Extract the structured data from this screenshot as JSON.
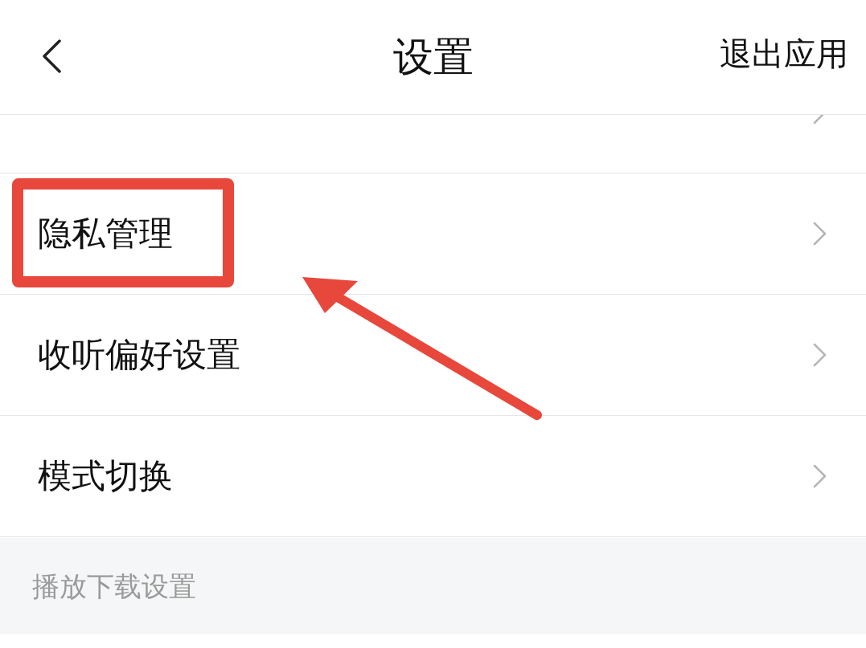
{
  "header": {
    "title": "设置",
    "action": "退出应用"
  },
  "rows": [
    {
      "kind": "cut",
      "highlighted": false
    },
    {
      "kind": "item",
      "label": "隐私管理",
      "highlighted": true
    },
    {
      "kind": "item",
      "label": "收听偏好设置",
      "highlighted": false
    },
    {
      "kind": "item",
      "label": "模式切换",
      "highlighted": false
    }
  ],
  "section_header": "播放下载设置"
}
